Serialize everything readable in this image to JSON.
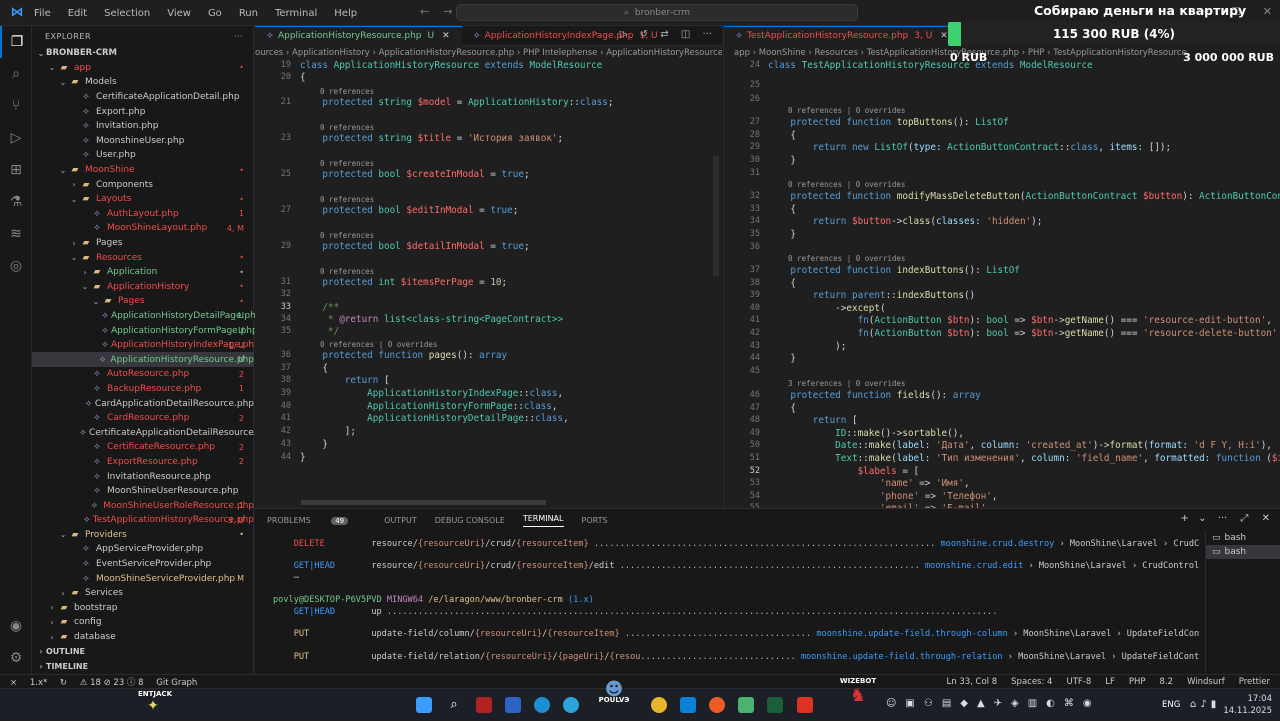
{
  "titlebar": {
    "menu": [
      "File",
      "Edit",
      "Selection",
      "View",
      "Go",
      "Run",
      "Terminal",
      "Help"
    ],
    "search": "bronber-crm"
  },
  "explorer": {
    "title": "EXPLORER",
    "root": "BRONBER-CRM",
    "items": [
      {
        "label": "app",
        "kind": "folder",
        "depth": 1,
        "color": "#f14c4c",
        "badge": "•",
        "badge_color": "#c74e39"
      },
      {
        "label": "Models",
        "kind": "folder",
        "depth": 2,
        "color": "#ccc",
        "badge": "",
        "badge_color": ""
      },
      {
        "label": "CertificateApplicationDetail.php",
        "kind": "php",
        "depth": 3,
        "color": "#ccc",
        "badge": "",
        "badge_color": ""
      },
      {
        "label": "Export.php",
        "kind": "php",
        "depth": 3,
        "color": "#ccc",
        "badge": "",
        "badge_color": ""
      },
      {
        "label": "Invitation.php",
        "kind": "php",
        "depth": 3,
        "color": "#ccc",
        "badge": "",
        "badge_color": ""
      },
      {
        "label": "MoonshineUser.php",
        "kind": "php",
        "depth": 3,
        "color": "#ccc",
        "badge": "",
        "badge_color": ""
      },
      {
        "label": "User.php",
        "kind": "php",
        "depth": 3,
        "color": "#ccc",
        "badge": "",
        "badge_color": ""
      },
      {
        "label": "MoonShine",
        "kind": "folder",
        "depth": 2,
        "color": "#f14c4c",
        "badge": "•",
        "badge_color": "#c74e39"
      },
      {
        "label": "Components",
        "kind": "folder",
        "depth": 3,
        "color": "#ccc",
        "badge": "",
        "badge_color": ""
      },
      {
        "label": "Layouts",
        "kind": "folder",
        "depth": 3,
        "color": "#f14c4c",
        "badge": "•",
        "badge_color": "#c74e39"
      },
      {
        "label": "AuthLayout.php",
        "kind": "php",
        "depth": 4,
        "color": "#f14c4c",
        "badge": "1",
        "badge_color": "#f14c4c"
      },
      {
        "label": "MoonShineLayout.php",
        "kind": "php",
        "depth": 4,
        "color": "#f14c4c",
        "badge": "4, M",
        "badge_color": "#f14c4c"
      },
      {
        "label": "Pages",
        "kind": "folder",
        "depth": 3,
        "color": "#ccc",
        "badge": "",
        "badge_color": ""
      },
      {
        "label": "Resources",
        "kind": "folder",
        "depth": 3,
        "color": "#f14c4c",
        "badge": "•",
        "badge_color": "#c74e39"
      },
      {
        "label": "Application",
        "kind": "folder",
        "depth": 4,
        "color": "#73c991",
        "badge": "•",
        "badge_color": "#73c991"
      },
      {
        "label": "ApplicationHistory",
        "kind": "folder",
        "depth": 4,
        "color": "#f14c4c",
        "badge": "•",
        "badge_color": "#c74e39"
      },
      {
        "label": "Pages",
        "kind": "folder",
        "depth": 5,
        "color": "#f14c4c",
        "badge": "•",
        "badge_color": "#c74e39"
      },
      {
        "label": "ApplicationHistoryDetailPage.php",
        "kind": "php",
        "depth": 6,
        "color": "#73c991",
        "badge": "U",
        "badge_color": "#73c991"
      },
      {
        "label": "ApplicationHistoryFormPage.php",
        "kind": "php",
        "depth": 6,
        "color": "#73c991",
        "badge": "U",
        "badge_color": "#73c991"
      },
      {
        "label": "ApplicationHistoryIndexPage.php",
        "kind": "php",
        "depth": 6,
        "color": "#f14c4c",
        "badge": "1, U",
        "badge_color": "#f14c4c"
      },
      {
        "label": "ApplicationHistoryResource.php",
        "kind": "php",
        "depth": 5,
        "color": "#73c991",
        "badge": "U",
        "badge_color": "#73c991",
        "selected": true
      },
      {
        "label": "AutoResource.php",
        "kind": "php",
        "depth": 4,
        "color": "#f14c4c",
        "badge": "2",
        "badge_color": "#f14c4c"
      },
      {
        "label": "BackupResource.php",
        "kind": "php",
        "depth": 4,
        "color": "#f14c4c",
        "badge": "1",
        "badge_color": "#f14c4c"
      },
      {
        "label": "CardApplicationDetailResource.php",
        "kind": "php",
        "depth": 4,
        "color": "#ccc",
        "badge": "",
        "badge_color": ""
      },
      {
        "label": "CardResource.php",
        "kind": "php",
        "depth": 4,
        "color": "#f14c4c",
        "badge": "2",
        "badge_color": "#f14c4c"
      },
      {
        "label": "CertificateApplicationDetailResource.php",
        "kind": "php",
        "depth": 4,
        "color": "#ccc",
        "badge": "",
        "badge_color": ""
      },
      {
        "label": "CertificateResource.php",
        "kind": "php",
        "depth": 4,
        "color": "#f14c4c",
        "badge": "2",
        "badge_color": "#f14c4c"
      },
      {
        "label": "ExportResource.php",
        "kind": "php",
        "depth": 4,
        "color": "#f14c4c",
        "badge": "2",
        "badge_color": "#f14c4c"
      },
      {
        "label": "InvitationResource.php",
        "kind": "php",
        "depth": 4,
        "color": "#ccc",
        "badge": "",
        "badge_color": ""
      },
      {
        "label": "MoonShineUserResource.php",
        "kind": "php",
        "depth": 4,
        "color": "#ccc",
        "badge": "",
        "badge_color": ""
      },
      {
        "label": "MoonShineUserRoleResource.php",
        "kind": "php",
        "depth": 4,
        "color": "#f14c4c",
        "badge": "1",
        "badge_color": "#f14c4c"
      },
      {
        "label": "TestApplicationHistoryResource.php",
        "kind": "php",
        "depth": 4,
        "color": "#f14c4c",
        "badge": "3, U",
        "badge_color": "#f14c4c"
      },
      {
        "label": "Providers",
        "kind": "folder",
        "depth": 2,
        "color": "#e2c08d",
        "badge": "•",
        "badge_color": "#e2c08d"
      },
      {
        "label": "AppServiceProvider.php",
        "kind": "php",
        "depth": 3,
        "color": "#ccc",
        "badge": "",
        "badge_color": ""
      },
      {
        "label": "EventServiceProvider.php",
        "kind": "php",
        "depth": 3,
        "color": "#ccc",
        "badge": "",
        "badge_color": ""
      },
      {
        "label": "MoonShineServiceProvider.php",
        "kind": "php",
        "depth": 3,
        "color": "#e2c08d",
        "badge": "M",
        "badge_color": "#e2c08d"
      },
      {
        "label": "Services",
        "kind": "folder",
        "depth": 2,
        "color": "#ccc",
        "badge": "",
        "badge_color": ""
      },
      {
        "label": "bootstrap",
        "kind": "folder",
        "depth": 1,
        "color": "#ccc",
        "badge": "",
        "badge_color": ""
      },
      {
        "label": "config",
        "kind": "folder",
        "depth": 1,
        "color": "#ccc",
        "badge": "",
        "badge_color": ""
      },
      {
        "label": "database",
        "kind": "folder",
        "depth": 1,
        "color": "#ccc",
        "badge": "",
        "badge_color": ""
      }
    ],
    "outline": "OUTLINE",
    "timeline": "TIMELINE"
  },
  "editor1": {
    "tabs": [
      {
        "label": "ApplicationHistoryResource.php",
        "status": "U",
        "color": "#73c991"
      },
      {
        "label": "ApplicationHistoryIndexPage.php",
        "status": "1, U",
        "color": "#f14c4c"
      }
    ],
    "breadcrumb": "ources › ApplicationHistory › ApplicationHistoryResource.php › PHP Intelephense › ApplicationHistoryResource"
  },
  "editor2": {
    "tabs": [
      {
        "label": "TestApplicationHistoryResource.php",
        "status": "3, U",
        "color": "#f14c4c"
      }
    ],
    "breadcrumb": "app › MoonShine › Resources › TestApplicationHistoryResource.php › PHP › TestApplicationHistoryResource"
  },
  "panel": {
    "tabs": [
      "PROBLEMS",
      "OUTPUT",
      "DEBUG CONSOLE",
      "TERMINAL",
      "PORTS"
    ],
    "problems_count": "49",
    "terminals": [
      "bash",
      "bash"
    ]
  },
  "overlay": {
    "title": "Собираю деньги на квартиру",
    "amount": "115 300 RUB (4%)",
    "progress_percent": 4,
    "min": "0 RUB",
    "max": "3 000 000 RUB"
  },
  "statusbar": {
    "left": [
      "⚠ 18  ⊘ 23  ⓘ 8",
      "Git Graph"
    ],
    "right": [
      "Ln 33, Col 8",
      "Spaces: 4",
      "UTF-8",
      "LF",
      "PHP",
      "8.2",
      "Windsurf",
      "Prettier"
    ]
  },
  "taskbar": {
    "streamer_left": "ENTJACK",
    "streamer_mid": "POULVЭ",
    "streamer_right": "WIZEBOT",
    "lang": "ENG",
    "time": "17:04",
    "date": "14.11.2025"
  }
}
